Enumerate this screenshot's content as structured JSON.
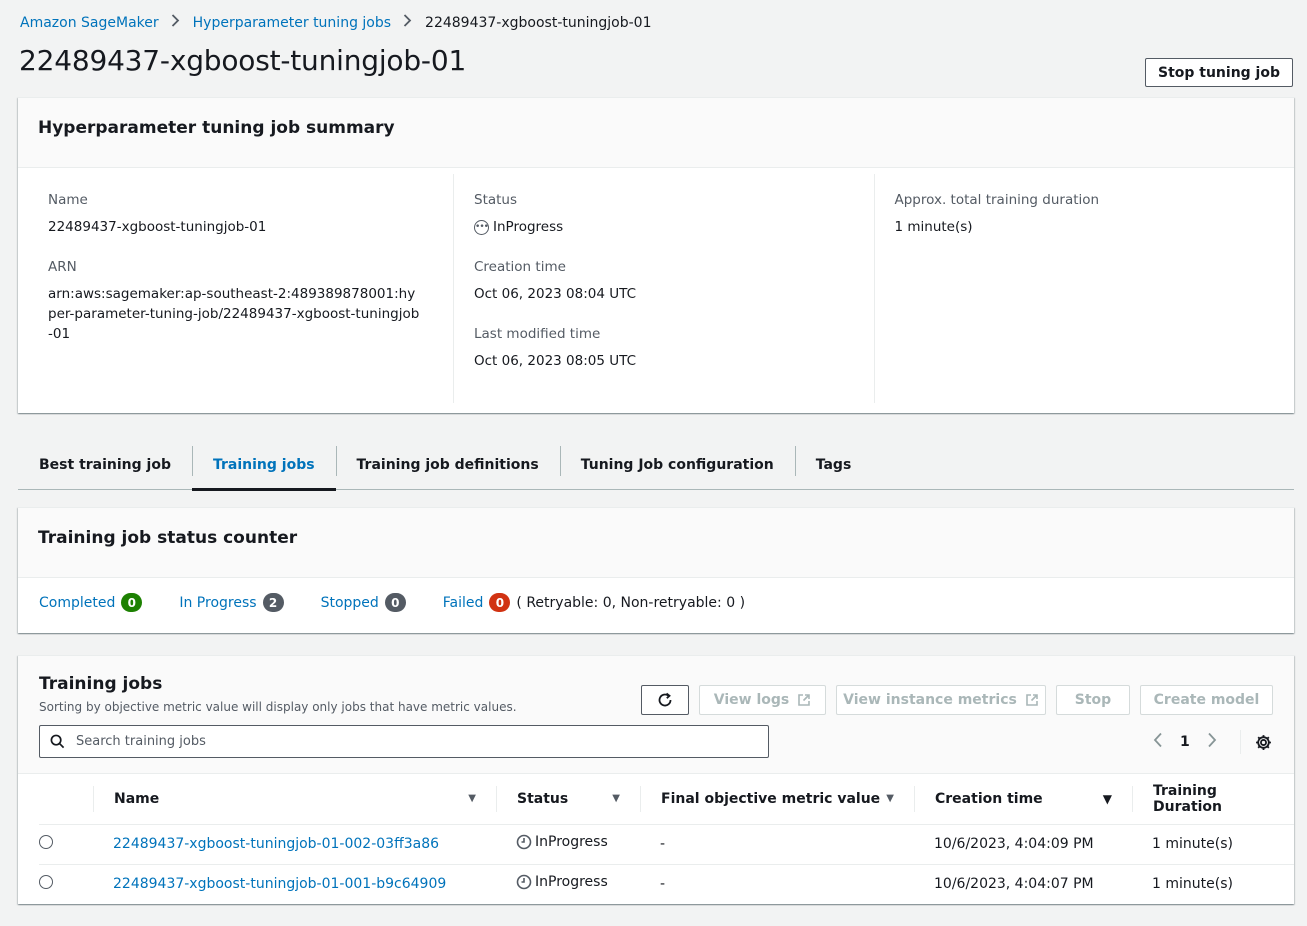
{
  "breadcrumb": {
    "items": [
      "Amazon SageMaker",
      "Hyperparameter tuning jobs"
    ],
    "current": "22489437-xgboost-tuningjob-01"
  },
  "page": {
    "title": "22489437-xgboost-tuningjob-01",
    "stop_button": "Stop tuning job"
  },
  "summary": {
    "heading": "Hyperparameter tuning job summary",
    "name_label": "Name",
    "name_value": "22489437-xgboost-tuningjob-01",
    "arn_label": "ARN",
    "arn_value": "arn:aws:sagemaker:ap-southeast-2:489389878001:hyper-parameter-tuning-job/22489437-xgboost-tuningjob-01",
    "status_label": "Status",
    "status_value": "InProgress",
    "creation_label": "Creation time",
    "creation_value": "Oct 06, 2023 08:04 UTC",
    "modified_label": "Last modified time",
    "modified_value": "Oct 06, 2023 08:05 UTC",
    "duration_label": "Approx. total training duration",
    "duration_value": "1 minute(s)"
  },
  "tabs": [
    {
      "label": "Best training job",
      "active": false
    },
    {
      "label": "Training jobs",
      "active": true
    },
    {
      "label": "Training job definitions",
      "active": false
    },
    {
      "label": "Tuning Job configuration",
      "active": false
    },
    {
      "label": "Tags",
      "active": false
    }
  ],
  "counter": {
    "heading": "Training job status counter",
    "items": [
      {
        "label": "Completed",
        "count": "0",
        "color": "#1d8102"
      },
      {
        "label": "In Progress",
        "count": "2",
        "color": "#545b64"
      },
      {
        "label": "Stopped",
        "count": "0",
        "color": "#545b64"
      },
      {
        "label": "Failed",
        "count": "0",
        "color": "#d13212"
      }
    ],
    "retry_text": "( Retryable: 0, Non-retryable: 0 )"
  },
  "jobs": {
    "heading": "Training jobs",
    "description": "Sorting by objective metric value will display only jobs that have metric values.",
    "actions": {
      "view_logs": "View logs",
      "view_metrics": "View instance metrics",
      "stop": "Stop",
      "create_model": "Create model"
    },
    "search_placeholder": "Search training jobs",
    "page": "1",
    "columns": [
      "Name",
      "Status",
      "Final objective metric value",
      "Creation time",
      "Training Duration"
    ],
    "rows": [
      {
        "name": "22489437-xgboost-tuningjob-01-002-03ff3a86",
        "status": "InProgress",
        "metric": "-",
        "created": "10/6/2023, 4:04:09 PM",
        "duration": "1 minute(s)"
      },
      {
        "name": "22489437-xgboost-tuningjob-01-001-b9c64909",
        "status": "InProgress",
        "metric": "-",
        "created": "10/6/2023, 4:04:07 PM",
        "duration": "1 minute(s)"
      }
    ]
  },
  "icons": {
    "breadcrumb_sep": "chevron-right-icon",
    "status": "status-in-progress-icon",
    "refresh": "refresh-icon",
    "external": "external-link-icon",
    "search": "search-icon",
    "prev": "chevron-left-icon",
    "next": "chevron-right-icon",
    "settings": "gear-icon",
    "sort": "caret-down-icon",
    "clock": "clock-icon"
  }
}
